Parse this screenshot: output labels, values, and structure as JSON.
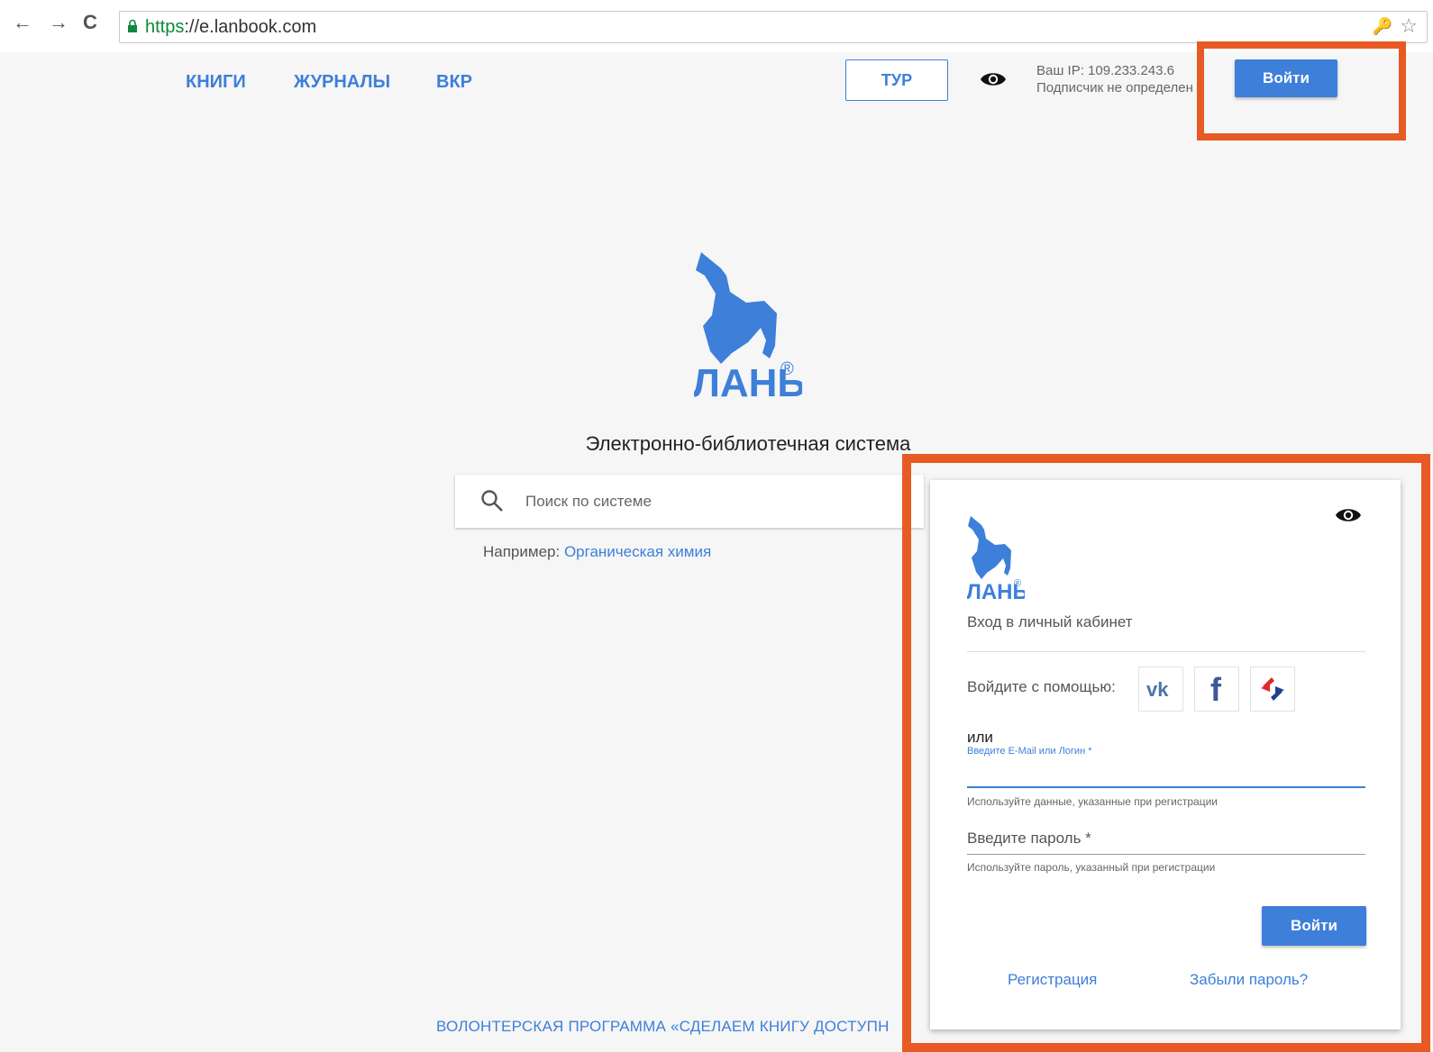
{
  "browser": {
    "url_scheme": "https",
    "url_rest": "://e.lanbook.com",
    "back": "←",
    "forward": "→",
    "reload": "C"
  },
  "topnav": {
    "books": "КНИГИ",
    "journals": "ЖУРНАЛЫ",
    "vkr": "ВКР",
    "tour": "ТУР",
    "ip_line": "Ваш IP: 109.233.243.6",
    "subscriber_line": "Подписчик не определен",
    "login": "Войти"
  },
  "hero": {
    "logo_text": "ЛАНЬ",
    "subtitle": "Электронно-библиотечная система",
    "search_placeholder": "Поиск по системе",
    "example_prefix": "Например: ",
    "example_link": "Органическая химия"
  },
  "footer": {
    "volunteer": "ВОЛОНТЕРСКАЯ ПРОГРАММА «СДЕЛАЕМ КНИГУ ДОСТУПН"
  },
  "login_card": {
    "logo_text": "ЛАНЬ",
    "title": "Вход в личный кабинет",
    "social_label": "Войдите с помощью:",
    "social": [
      "vk-icon",
      "facebook-icon",
      "esia-icon"
    ],
    "or": "или",
    "email_label": "Введите E-Mail или Логин *",
    "email_value": "",
    "email_hint": "Используйте данные, указанные при регистрации",
    "password_placeholder": "Введите пароль *",
    "password_hint": "Используйте пароль, указанный при регистрации",
    "submit": "Войти",
    "register": "Регистрация",
    "forgot": "Забыли пароль?"
  },
  "colors": {
    "accent": "#3d7fd9",
    "highlight": "#e85a23",
    "vk": "#4a76a8",
    "facebook": "#3b5998"
  }
}
